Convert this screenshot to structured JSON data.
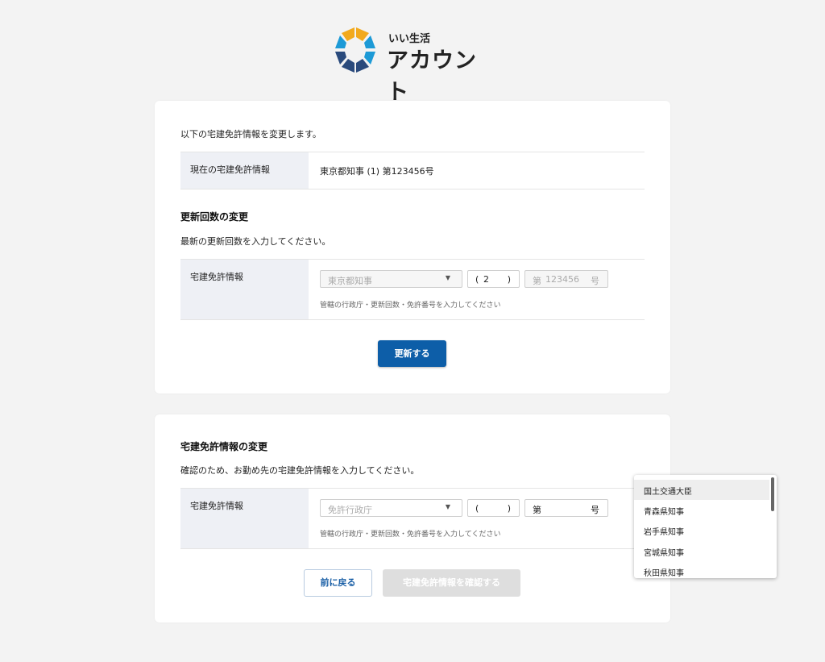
{
  "logo": {
    "small": "いい生活",
    "big": "アカウント"
  },
  "card1": {
    "intro": "以下の宅建免許情報を変更します。",
    "current_label": "現在の宅建免許情報",
    "current_value": "東京都知事 (1) 第123456号",
    "section_title": "更新回数の変更",
    "section_desc": "最新の更新回数を入力してください。",
    "row_label": "宅建免許情報",
    "authority": "東京都知事",
    "paren_open": "(",
    "count": "2",
    "paren_close": ")",
    "number_prefix": "第",
    "number": "123456",
    "number_suffix": "号",
    "help": "管轄の行政庁・更新回数・免許番号を入力してください",
    "submit": "更新する"
  },
  "card2": {
    "section_title": "宅建免許情報の変更",
    "section_desc": "確認のため、お勤め先の宅建免許情報を入力してください。",
    "row_label": "宅建免許情報",
    "authority_placeholder": "免許行政庁",
    "paren_open": "(",
    "paren_close": ")",
    "number_prefix": "第",
    "number_suffix": "号",
    "help": "管轄の行政庁・更新回数・免許番号を入力してください",
    "back": "前に戻る",
    "confirm": "宅建免許情報を確認する"
  },
  "dropdown": {
    "options": [
      "国土交通大臣",
      "青森県知事",
      "岩手県知事",
      "宮城県知事",
      "秋田県知事"
    ]
  },
  "colors": {
    "primary": "#0d5ea8",
    "label_bg": "#eef0f5",
    "page_bg": "#f3f3f3"
  }
}
